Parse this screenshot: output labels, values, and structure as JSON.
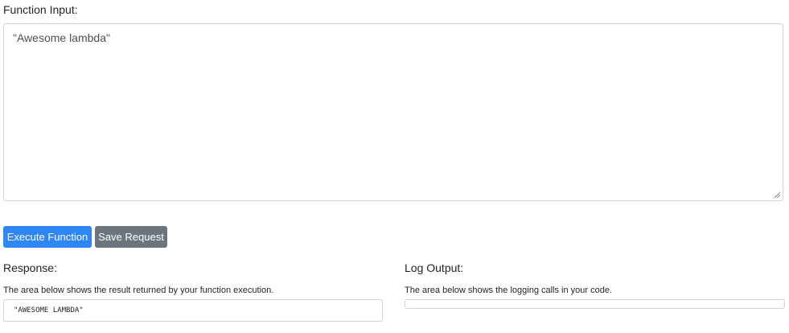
{
  "function_input": {
    "label": "Function Input:",
    "value": "\"Awesome lambda\""
  },
  "buttons": {
    "execute": "Execute Function",
    "save": "Save Request"
  },
  "response": {
    "label": "Response:",
    "help": "The area below shows the result returned by your function execution.",
    "value": "\"AWESOME LAMBDA\""
  },
  "log_output": {
    "label": "Log Output:",
    "help": "The area below shows the logging calls in your code.",
    "value": ""
  },
  "colors": {
    "primary": "#2f86f6",
    "secondary": "#6c757d",
    "border": "#ced4da"
  }
}
